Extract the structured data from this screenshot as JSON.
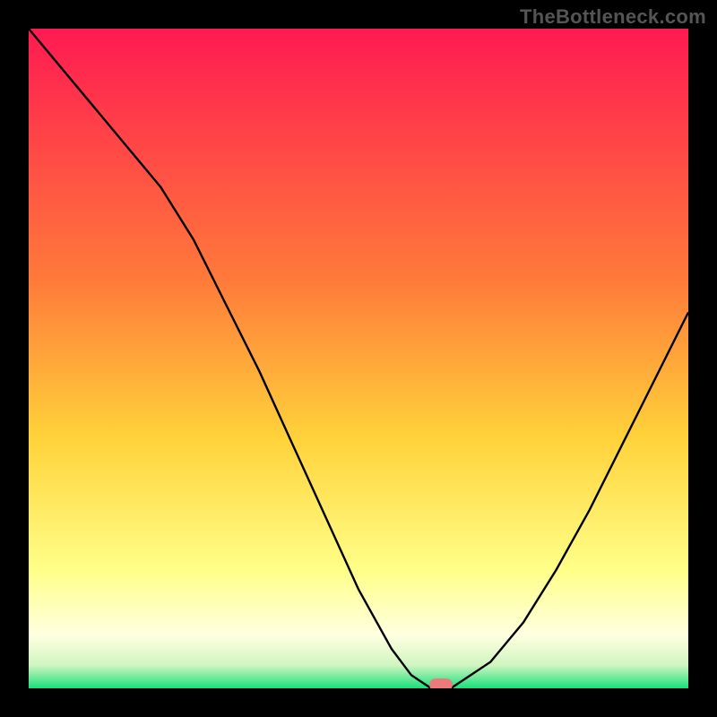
{
  "watermark": "TheBottleneck.com",
  "colors": {
    "background_black": "#000000",
    "gradient_top": "#ff1a52",
    "gradient_mid_orange": "#ff9a2a",
    "gradient_yellow": "#ffe633",
    "gradient_pale_yellow": "#ffffcc",
    "gradient_bottom_green": "#18e07a",
    "curve_stroke": "#000000",
    "marker_fill": "#ec7a7d",
    "watermark_color": "#555555"
  },
  "chart_data": {
    "type": "line",
    "title": "",
    "xlabel": "",
    "ylabel": "",
    "xlim": [
      0,
      100
    ],
    "ylim": [
      0,
      100
    ],
    "x": [
      0,
      5,
      10,
      15,
      20,
      25,
      30,
      35,
      40,
      45,
      50,
      55,
      58,
      61,
      64,
      70,
      75,
      80,
      85,
      90,
      95,
      100
    ],
    "values": [
      100,
      94,
      88,
      82,
      76,
      68,
      58,
      48,
      37,
      26,
      15,
      6,
      2,
      0,
      0,
      4,
      10,
      18,
      27,
      37,
      47,
      57
    ],
    "marker": {
      "x": 62.5,
      "y": 0
    },
    "gradient_stops": [
      {
        "offset": 0.0,
        "color": "#ff1a52"
      },
      {
        "offset": 0.38,
        "color": "#ff7a3a"
      },
      {
        "offset": 0.62,
        "color": "#ffd23a"
      },
      {
        "offset": 0.82,
        "color": "#ffff88"
      },
      {
        "offset": 0.92,
        "color": "#ffffe0"
      },
      {
        "offset": 0.965,
        "color": "#d0f5c0"
      },
      {
        "offset": 1.0,
        "color": "#18e07a"
      }
    ]
  }
}
